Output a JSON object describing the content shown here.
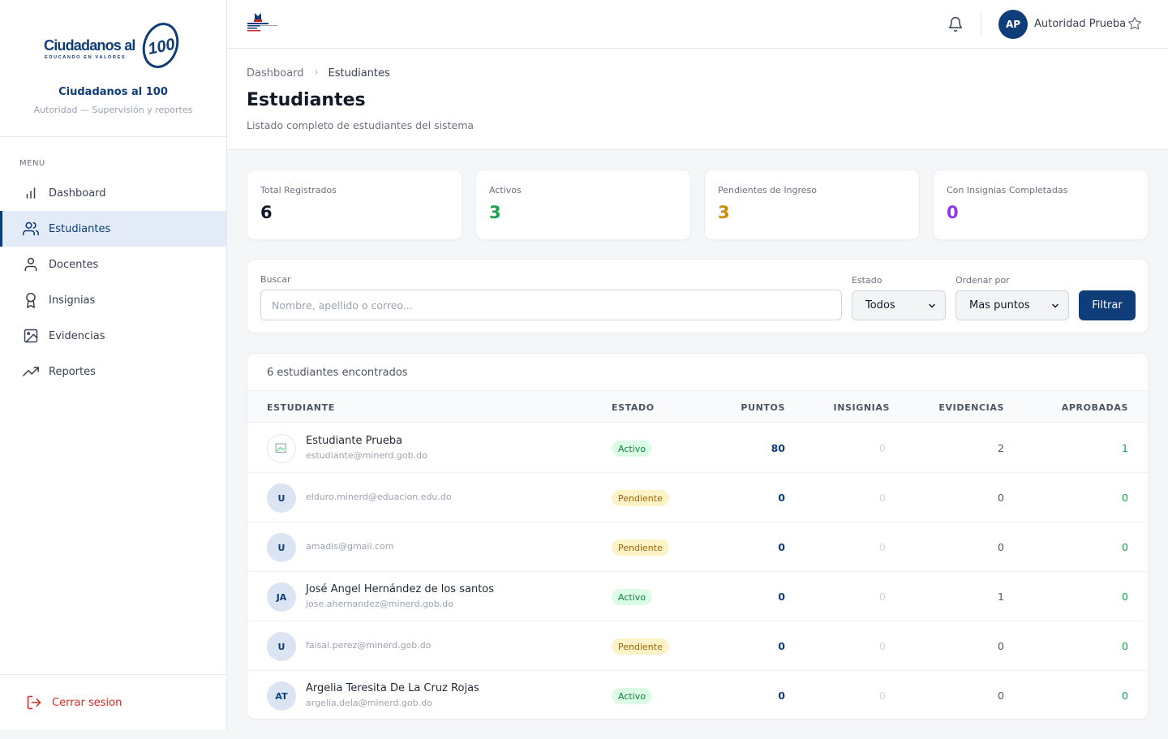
{
  "brand": {
    "logo_text": "Ciudadanos al",
    "logo_number": "100",
    "logo_tagline": "EDUCANDO EN VALORES",
    "title": "Ciudadanos al 100",
    "subtitle": "Autoridad — Supervisión y reportes"
  },
  "sidebar": {
    "menu_label": "MENU",
    "items": [
      {
        "label": "Dashboard",
        "icon": "bar-chart-icon"
      },
      {
        "label": "Estudiantes",
        "icon": "users-icon",
        "active": true
      },
      {
        "label": "Docentes",
        "icon": "user-icon"
      },
      {
        "label": "Insignias",
        "icon": "award-icon"
      },
      {
        "label": "Evidencias",
        "icon": "image-icon"
      },
      {
        "label": "Reportes",
        "icon": "trending-up-icon"
      }
    ],
    "logout_label": "Cerrar sesion"
  },
  "topbar": {
    "user_initials": "AP",
    "user_name": "Autoridad Prueba"
  },
  "header": {
    "breadcrumb": [
      "Dashboard",
      "Estudiantes"
    ],
    "title": "Estudiantes",
    "subtitle": "Listado completo de estudiantes del sistema"
  },
  "stats": [
    {
      "label": "Total Registrados",
      "value": "6",
      "color": "#111827"
    },
    {
      "label": "Activos",
      "value": "3",
      "color": "#16a34a"
    },
    {
      "label": "Pendientes de Ingreso",
      "value": "3",
      "color": "#ca8a04"
    },
    {
      "label": "Con Insignias Completadas",
      "value": "0",
      "color": "#9333ea"
    }
  ],
  "filters": {
    "search_label": "Buscar",
    "search_placeholder": "Nombre, apellido o correo...",
    "estado_label": "Estado",
    "estado_value": "Todos",
    "orden_label": "Ordenar por",
    "orden_value": "Mas puntos",
    "filter_button": "Filtrar"
  },
  "table": {
    "count_text": "6 estudiantes encontrados",
    "headers": [
      "ESTUDIANTE",
      "ESTADO",
      "PUNTOS",
      "INSIGNIAS",
      "EVIDENCIAS",
      "APROBADAS"
    ],
    "rows": [
      {
        "initials": "",
        "name": "Estudiante Prueba",
        "email": "estudiante@minerd.gob.do",
        "status": "Activo",
        "points": "80",
        "badges": "0",
        "evidences": "2",
        "approved": "1"
      },
      {
        "initials": "U",
        "name": "",
        "email": "elduro.minerd@eduacion.edu.do",
        "status": "Pendiente",
        "points": "0",
        "badges": "0",
        "evidences": "0",
        "approved": "0"
      },
      {
        "initials": "U",
        "name": "",
        "email": "amadis@gmail.com",
        "status": "Pendiente",
        "points": "0",
        "badges": "0",
        "evidences": "0",
        "approved": "0"
      },
      {
        "initials": "JA",
        "name": "José Angel Hernández de los santos",
        "email": "jose.ahernandez@minerd.gob.do",
        "status": "Activo",
        "points": "0",
        "badges": "0",
        "evidences": "1",
        "approved": "0"
      },
      {
        "initials": "U",
        "name": "",
        "email": "faisal.perez@minerd.gob.do",
        "status": "Pendiente",
        "points": "0",
        "badges": "0",
        "evidences": "0",
        "approved": "0"
      },
      {
        "initials": "AT",
        "name": "Argelia Teresita De La Cruz Rojas",
        "email": "argelia.dela@minerd.gob.do",
        "status": "Activo",
        "points": "0",
        "badges": "0",
        "evidences": "0",
        "approved": "0"
      }
    ]
  },
  "colors": {
    "brand_navy": "#0e3d7a",
    "active_bg": "#e2ebf7",
    "logout_red": "#dc2626"
  }
}
